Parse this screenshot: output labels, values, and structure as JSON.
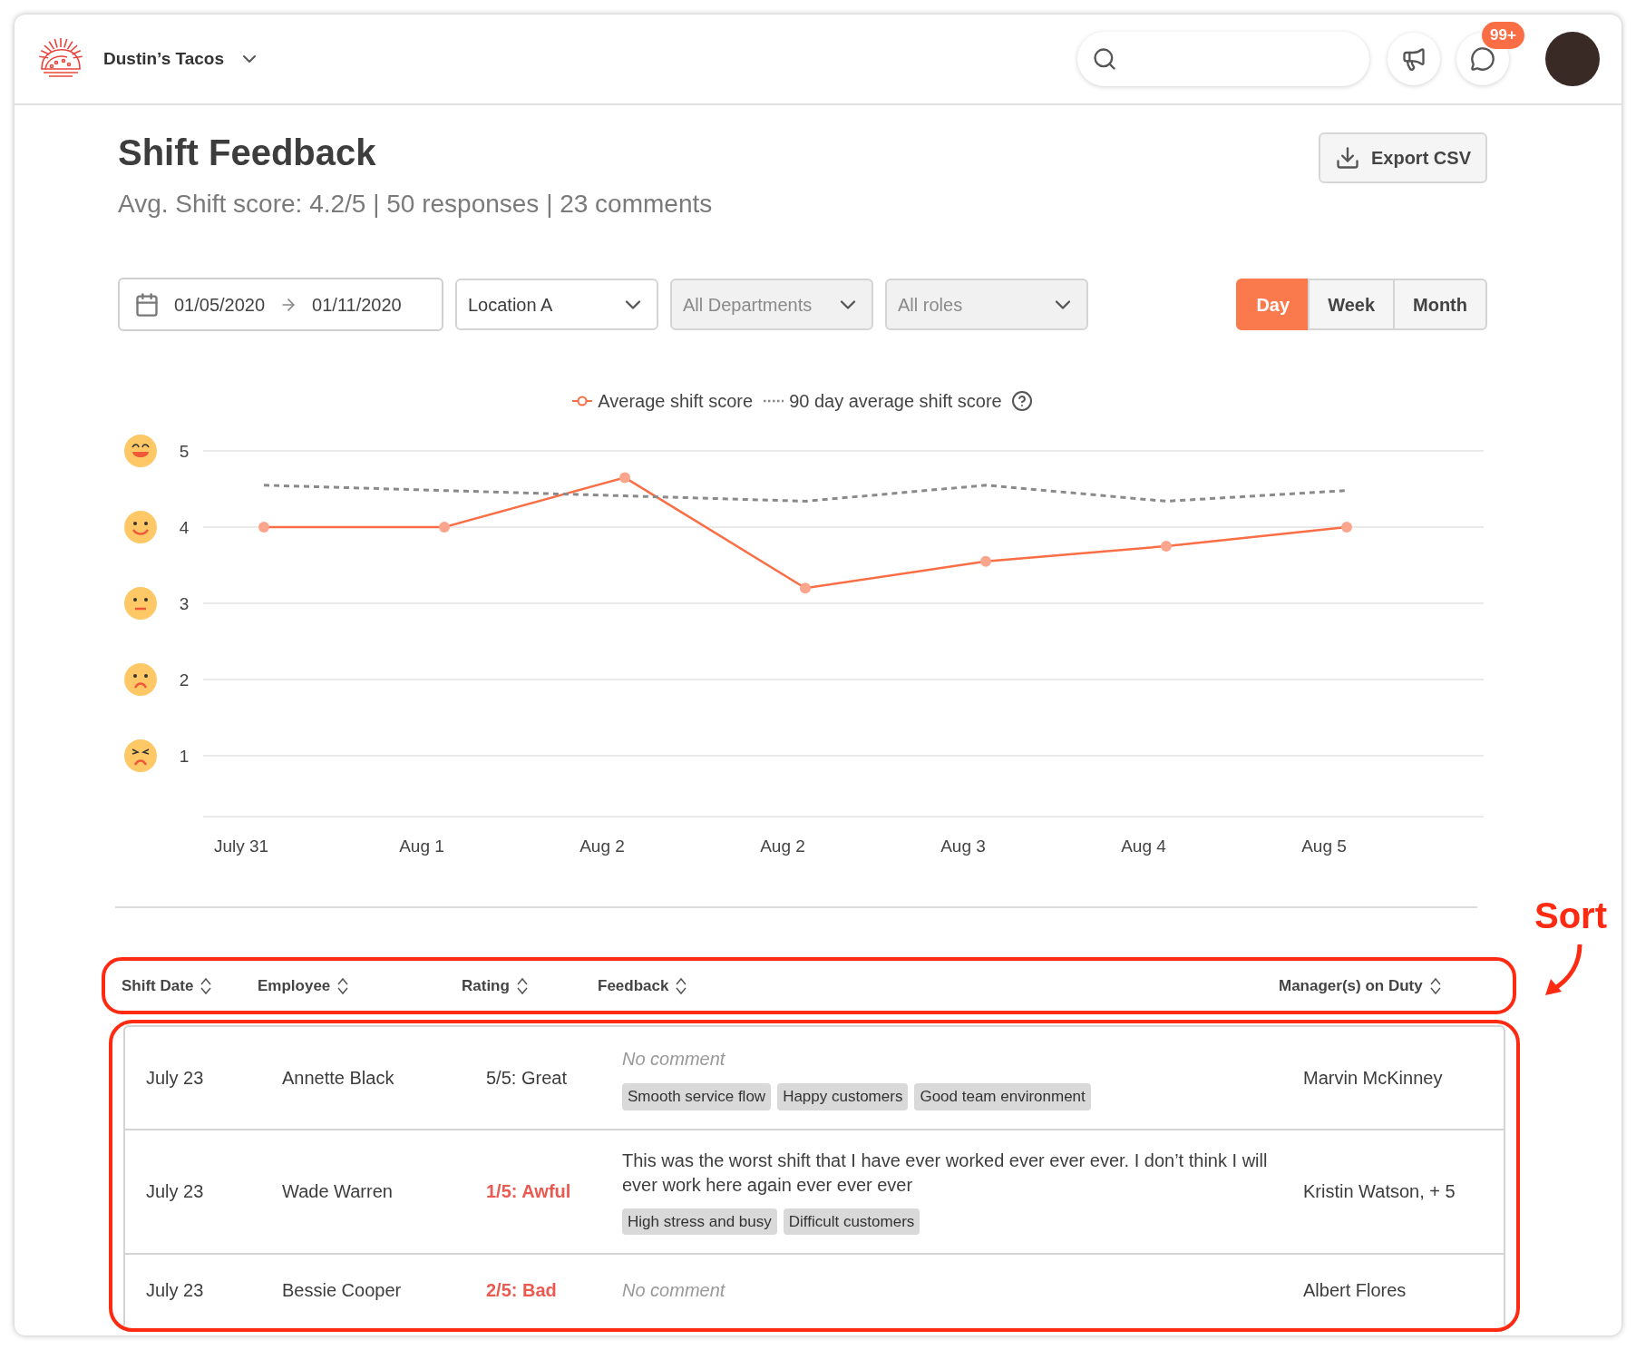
{
  "header": {
    "business": "Dustin’s Tacos",
    "notifications_badge": "99+"
  },
  "page": {
    "title": "Shift Feedback",
    "summary": "Avg. Shift score: 4.2/5 | 50 responses | 23 comments",
    "export_button": "Export CSV"
  },
  "filters": {
    "date_start": "01/05/2020",
    "date_end": "01/11/2020",
    "selects": [
      {
        "value": "Location A",
        "disabled": false
      },
      {
        "value": "All Departments",
        "disabled": true
      },
      {
        "value": "All roles",
        "disabled": true
      }
    ],
    "periods": [
      {
        "label": "Day",
        "selected": true
      },
      {
        "label": "Week",
        "selected": false
      },
      {
        "label": "Month",
        "selected": false
      }
    ]
  },
  "chart_data": {
    "type": "line",
    "grid": true,
    "categories": [
      "July 31",
      "Aug 1",
      "Aug 2",
      "Aug 2",
      "Aug 3",
      "Aug 4",
      "Aug 5"
    ],
    "ylim": [
      0.2,
      5
    ],
    "yticks": [
      5,
      4,
      3,
      2,
      1
    ],
    "series": [
      {
        "name": "Average shift score",
        "color": "#fa6e45",
        "marker": "circle",
        "line_style": "solid",
        "values": [
          4,
          4,
          4.65,
          3.2,
          3.55,
          3.75,
          4
        ]
      },
      {
        "name": "90 day average shift score",
        "color": "#8a8a8a",
        "line_style": "dotted",
        "values": [
          4.55,
          4.48,
          4.41,
          4.34,
          4.55,
          4.34,
          4.48
        ]
      }
    ]
  },
  "table": {
    "columns": [
      "Shift Date",
      "Employee",
      "Rating",
      "Feedback",
      "Manager(s) on Duty"
    ],
    "rows": [
      {
        "date": "July 23",
        "employee": "Annette Black",
        "rating": "5/5: Great",
        "negative": false,
        "feedback": {
          "kind": "empty",
          "text": "No comment"
        },
        "tags": [
          "Smooth service flow",
          "Happy customers",
          "Good team environment"
        ],
        "managers": "Marvin McKinney"
      },
      {
        "date": "July 23",
        "employee": "Wade Warren",
        "rating": "1/5: Awful",
        "negative": true,
        "feedback": {
          "kind": "comment",
          "text": "This was the worst shift that I have ever worked ever ever ever. I don’t think I will ever work here again ever ever ever"
        },
        "tags": [
          "High stress and busy",
          "Difficult customers"
        ],
        "managers": "Kristin Watson, + 5"
      },
      {
        "date": "July 23",
        "employee": "Bessie Cooper",
        "rating": "2/5: Bad",
        "negative": true,
        "feedback": {
          "kind": "empty",
          "text": "No comment"
        },
        "tags": [],
        "managers": "Albert Flores"
      }
    ]
  },
  "annotation": {
    "label": "Sort"
  }
}
